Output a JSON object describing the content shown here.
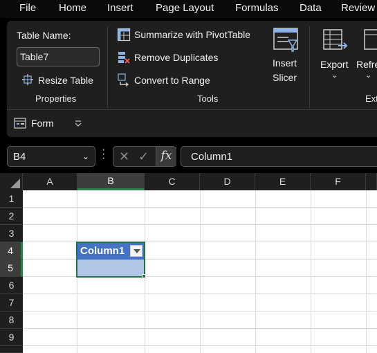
{
  "menu": [
    "File",
    "Home",
    "Insert",
    "Page Layout",
    "Formulas",
    "Data",
    "Review"
  ],
  "ribbon": {
    "properties": {
      "table_name_label": "Table Name:",
      "table_name_value": "Table7",
      "resize_table_label": "Resize Table",
      "group_label": "Properties"
    },
    "tools": {
      "summarize_label": "Summarize with PivotTable",
      "remove_duplicates_label": "Remove Duplicates",
      "convert_label": "Convert to Range",
      "insert_slicer_line1": "Insert",
      "insert_slicer_line2": "Slicer",
      "group_label": "Tools"
    },
    "external": {
      "export_label": "Export",
      "refresh_label": "Refre",
      "group_label": "Ext"
    },
    "form_label": "Form"
  },
  "formula_bar": {
    "name_box": "B4",
    "fx_label": "fx",
    "formula": "Column1"
  },
  "grid": {
    "columns": [
      "A",
      "B",
      "C",
      "D",
      "E",
      "F"
    ],
    "rows": [
      "1",
      "2",
      "3",
      "4",
      "5",
      "6",
      "7",
      "8",
      "9"
    ],
    "selected_column": "B",
    "selected_rows": [
      "4",
      "5"
    ],
    "table_header": "Column1",
    "colors": {
      "table_header": "#4472c4",
      "table_row": "#b4c6e7",
      "selection": "#217346"
    }
  }
}
